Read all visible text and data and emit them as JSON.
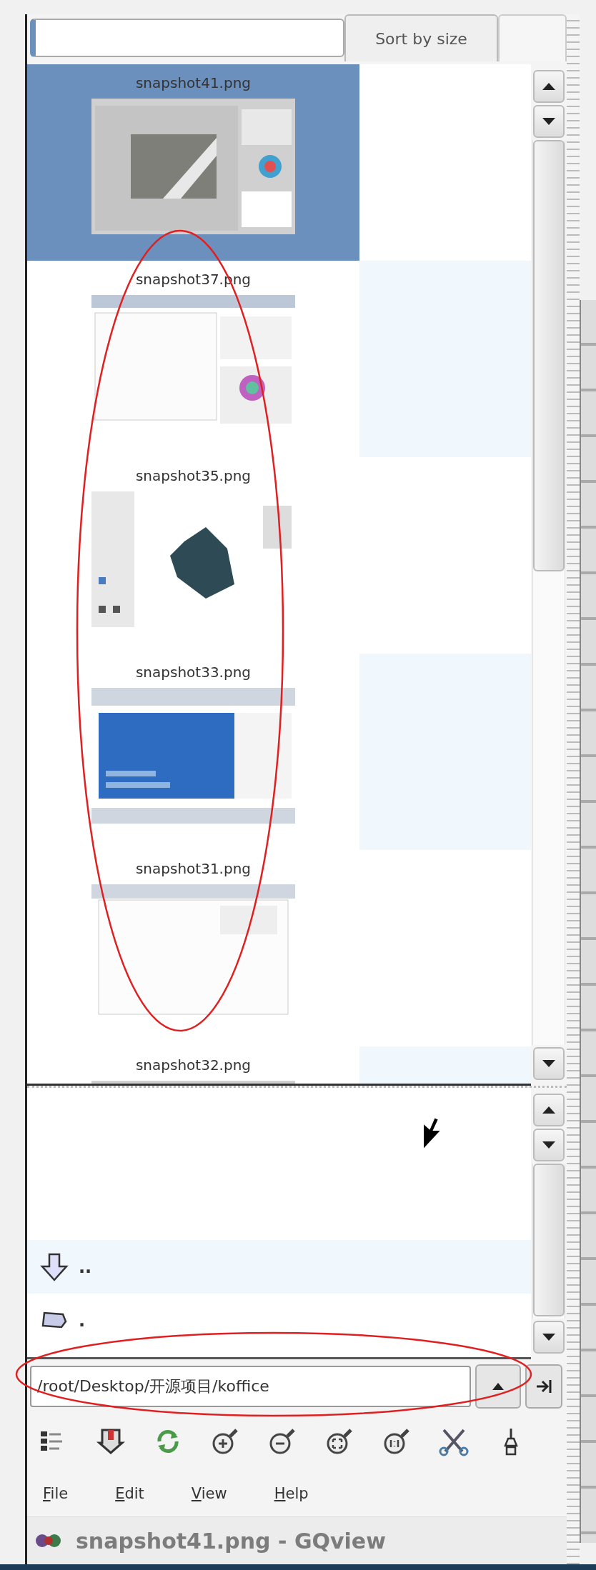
{
  "sort_button": "Sort by size",
  "thumbnails": [
    {
      "label": "snapshot41.png",
      "selected": true
    },
    {
      "label": "snapshot37.png",
      "selected": false
    },
    {
      "label": "snapshot35.png",
      "selected": false
    },
    {
      "label": "snapshot33.png",
      "selected": false
    },
    {
      "label": "snapshot31.png",
      "selected": false
    },
    {
      "label": "snapshot32.png",
      "selected": false
    }
  ],
  "directory_list": [
    {
      "kind": "parent",
      "name": ".."
    },
    {
      "kind": "current",
      "name": "."
    }
  ],
  "path_field": {
    "value": "/root/Desktop/开源项目/koffice"
  },
  "menu": [
    "File",
    "Edit",
    "View",
    "Help"
  ],
  "window": {
    "title": "snapshot41.png - GQview"
  }
}
